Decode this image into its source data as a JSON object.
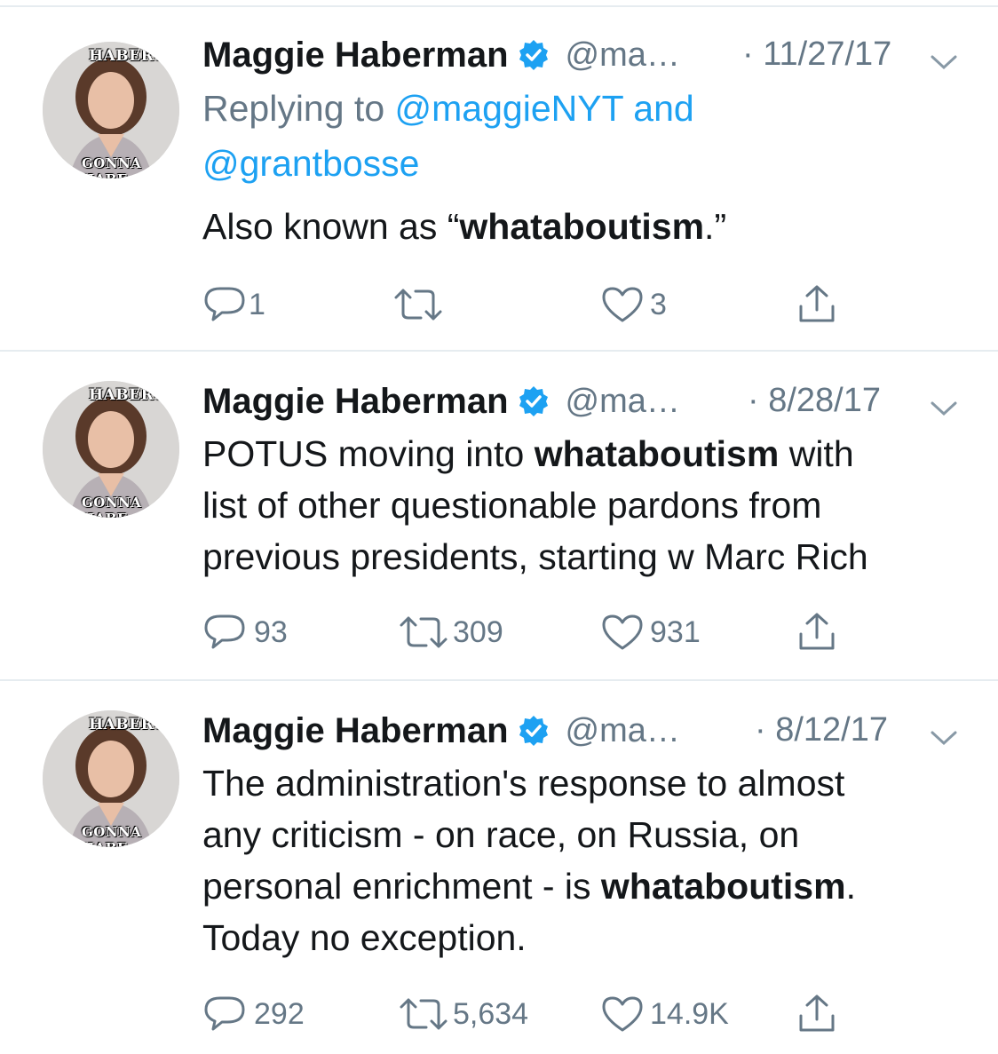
{
  "tweets": [
    {
      "name": "Maggie Haberman",
      "handle": "@ma…",
      "date": "· 11/27/17",
      "reply_prefix": "Replying to",
      "reply_mention_1": "@maggieNYT",
      "reply_and": "and",
      "reply_mention_2": "@grantbosse",
      "text_parts": [
        "Also known as “",
        "whataboutism",
        ".”"
      ],
      "replies": "1",
      "retweets": "",
      "likes": "3"
    },
    {
      "name": "Maggie Haberman",
      "handle": "@ma…",
      "date": "· 8/28/17",
      "line1_a": "POTUS moving into ",
      "line1_b": "whataboutism",
      "line1_c": " with",
      "line2": "list of other questionable pardons from",
      "line3": "previous presidents, starting w Marc Rich",
      "replies": "93",
      "retweets": "309",
      "likes": "931"
    },
    {
      "name": "Maggie Haberman",
      "handle": "@ma…",
      "date": "· 8/12/17",
      "line1": "The administration's response to almost",
      "line2": "any criticism - on race, on Russia, on",
      "line3_a": "personal enrichment - is ",
      "line3_b": "whataboutism",
      "line3_c": ".",
      "line4": "Today no exception.",
      "replies": "292",
      "retweets": "5,634",
      "likes": "14.9K"
    }
  ],
  "avatar": {
    "top_text": "HABERS",
    "bottom_text": "GONNA HABE"
  },
  "colors": {
    "text": "#14171a",
    "secondary": "#657786",
    "link": "#1da1f2",
    "verified": "#1da1f2",
    "divider": "#e6ecf0"
  },
  "icons": [
    "reply-icon",
    "retweet-icon",
    "like-icon",
    "share-icon",
    "verified-badge-icon",
    "chevron-down-icon"
  ]
}
